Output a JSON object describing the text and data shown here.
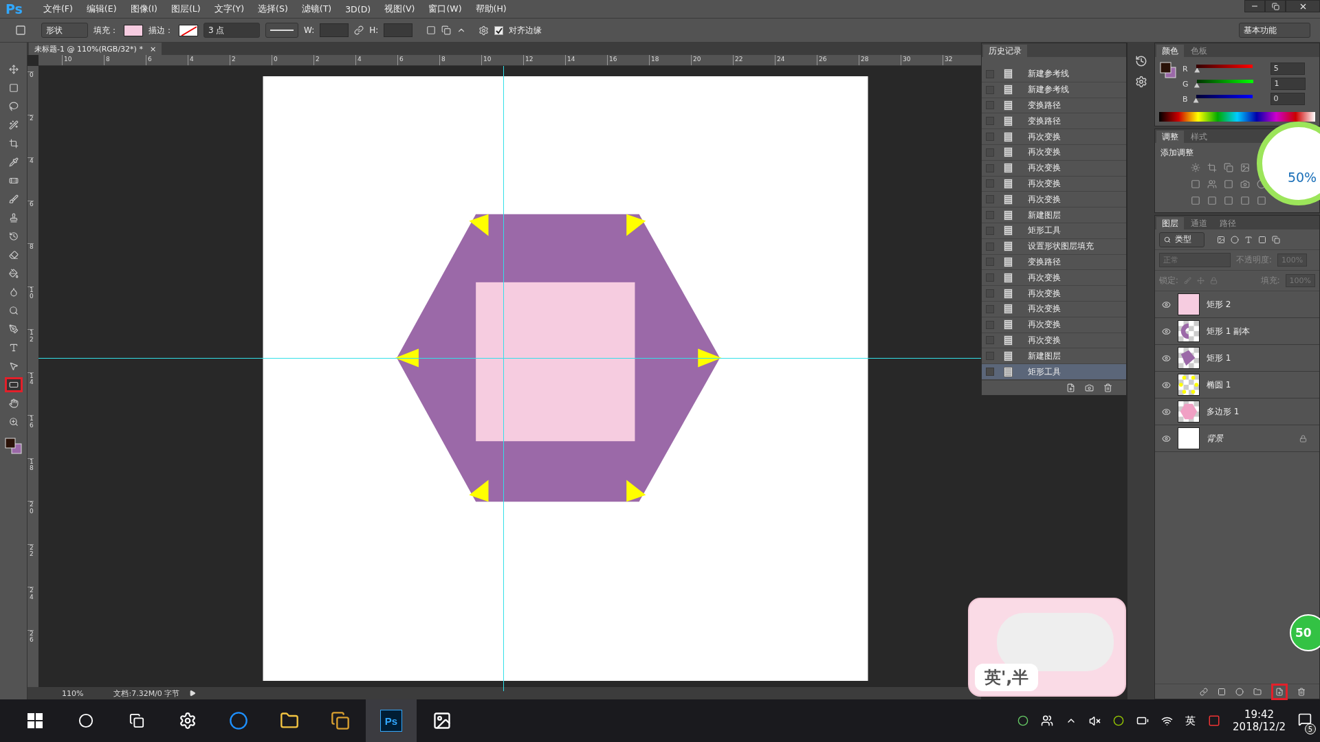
{
  "menu_bar": {
    "logo": "Ps",
    "items": [
      "文件(F)",
      "编辑(E)",
      "图像(I)",
      "图层(L)",
      "文字(Y)",
      "选择(S)",
      "滤镜(T)",
      "3D(D)",
      "视图(V)",
      "窗口(W)",
      "帮助(H)"
    ]
  },
  "options_bar": {
    "mode": "形状",
    "fill_label": "填充：",
    "stroke_label": "描边：",
    "stroke_width": "3 点",
    "w_label": "W:",
    "h_label": "H:",
    "align_edges": {
      "label": "对齐边缘",
      "checked": true
    },
    "workspace": "基本功能"
  },
  "document_tab": {
    "title": "未标题-1 @ 110%(RGB/32*) *",
    "close": "×"
  },
  "ruler": {
    "horizontal": [
      "10",
      "8",
      "6",
      "4",
      "2",
      "0",
      "2",
      "4",
      "6",
      "8",
      "10",
      "12",
      "14",
      "16",
      "18",
      "20",
      "22",
      "24",
      "26",
      "28",
      "30",
      "32"
    ],
    "vertical": [
      "0",
      "2",
      "4",
      "6",
      "8",
      "10",
      "12",
      "14",
      "16",
      "18",
      "20",
      "22",
      "24",
      "26"
    ]
  },
  "tools": [
    {
      "kind": "move",
      "selected": false
    },
    {
      "kind": "marquee",
      "selected": false
    },
    {
      "kind": "lasso",
      "selected": false
    },
    {
      "kind": "wand",
      "selected": false
    },
    {
      "kind": "crop",
      "selected": false
    },
    {
      "kind": "eyedropper",
      "selected": false
    },
    {
      "kind": "heal",
      "selected": false
    },
    {
      "kind": "brush",
      "selected": false
    },
    {
      "kind": "stamp",
      "selected": false
    },
    {
      "kind": "history",
      "selected": false
    },
    {
      "kind": "eraser",
      "selected": false
    },
    {
      "kind": "bucket",
      "selected": false
    },
    {
      "kind": "blur",
      "selected": false
    },
    {
      "kind": "dodge",
      "selected": false
    },
    {
      "kind": "pen",
      "selected": false
    },
    {
      "kind": "type",
      "selected": false
    },
    {
      "kind": "path",
      "selected": false
    },
    {
      "kind": "rectangle",
      "selected": true
    },
    {
      "kind": "hand",
      "selected": false
    },
    {
      "kind": "zoom",
      "selected": false
    }
  ],
  "status_bar": {
    "zoom": "110%",
    "doc_info": "文档:7.32M/0 字节"
  },
  "history": {
    "title": "历史记录",
    "items": [
      {
        "label": "新建参考线",
        "selected": false
      },
      {
        "label": "新建参考线",
        "selected": false
      },
      {
        "label": "变换路径",
        "selected": false
      },
      {
        "label": "变换路径",
        "selected": false
      },
      {
        "label": "再次变换",
        "selected": false
      },
      {
        "label": "再次变换",
        "selected": false
      },
      {
        "label": "再次变换",
        "selected": false
      },
      {
        "label": "再次变换",
        "selected": false
      },
      {
        "label": "再次变换",
        "selected": false
      },
      {
        "label": "新建图层",
        "selected": false
      },
      {
        "label": "矩形工具",
        "selected": false
      },
      {
        "label": "设置形状图层填充",
        "selected": false
      },
      {
        "label": "变换路径",
        "selected": false
      },
      {
        "label": "再次变换",
        "selected": false
      },
      {
        "label": "再次变换",
        "selected": false
      },
      {
        "label": "再次变换",
        "selected": false
      },
      {
        "label": "再次变换",
        "selected": false
      },
      {
        "label": "再次变换",
        "selected": false
      },
      {
        "label": "新建图层",
        "selected": false
      },
      {
        "label": "矩形工具",
        "selected": true
      }
    ]
  },
  "color_panel": {
    "tabs": [
      {
        "label": "颜色",
        "selected": true
      },
      {
        "label": "色板",
        "selected": false
      }
    ],
    "channels": [
      {
        "name": "R",
        "level": 0.02,
        "value": "5"
      },
      {
        "name": "G",
        "level": 0.004,
        "value": "1"
      },
      {
        "name": "B",
        "level": 0,
        "value": "0"
      }
    ]
  },
  "adjustments_panel": {
    "tabs": [
      {
        "label": "调整",
        "selected": true
      },
      {
        "label": "样式",
        "selected": false
      }
    ],
    "title": "添加调整"
  },
  "layers_panel": {
    "tabs": [
      {
        "label": "图层",
        "selected": true
      },
      {
        "label": "通道",
        "selected": false
      },
      {
        "label": "路径",
        "selected": false
      }
    ],
    "filter": "类型",
    "blend_mode": "正常",
    "opacity_label": "不透明度:",
    "opacity": "100%",
    "lock_label": "锁定:",
    "fill_label": "填充:",
    "fill": "100%",
    "layers": [
      {
        "name": "矩形 2",
        "kind": "pink",
        "visible": true,
        "locked": false
      },
      {
        "name": "矩形 1 副本",
        "kind": "arc",
        "visible": true,
        "locked": false
      },
      {
        "name": "矩形 1",
        "kind": "shape",
        "visible": true,
        "locked": false
      },
      {
        "name": "椭圆 1",
        "kind": "dots",
        "visible": true,
        "locked": false
      },
      {
        "name": "多边形 1",
        "kind": "polygon",
        "visible": true,
        "locked": false
      },
      {
        "name": "背景",
        "kind": "white",
        "visible": true,
        "locked": true
      }
    ]
  },
  "speed_widget": {
    "percent": "50%"
  },
  "ime_widget": {
    "text": "英',半"
  },
  "green_badge": "50",
  "taskbar": {
    "ps_label": "Ps",
    "ime": "英",
    "time": "19:42",
    "date": "2018/12/2",
    "notifications": "5"
  }
}
